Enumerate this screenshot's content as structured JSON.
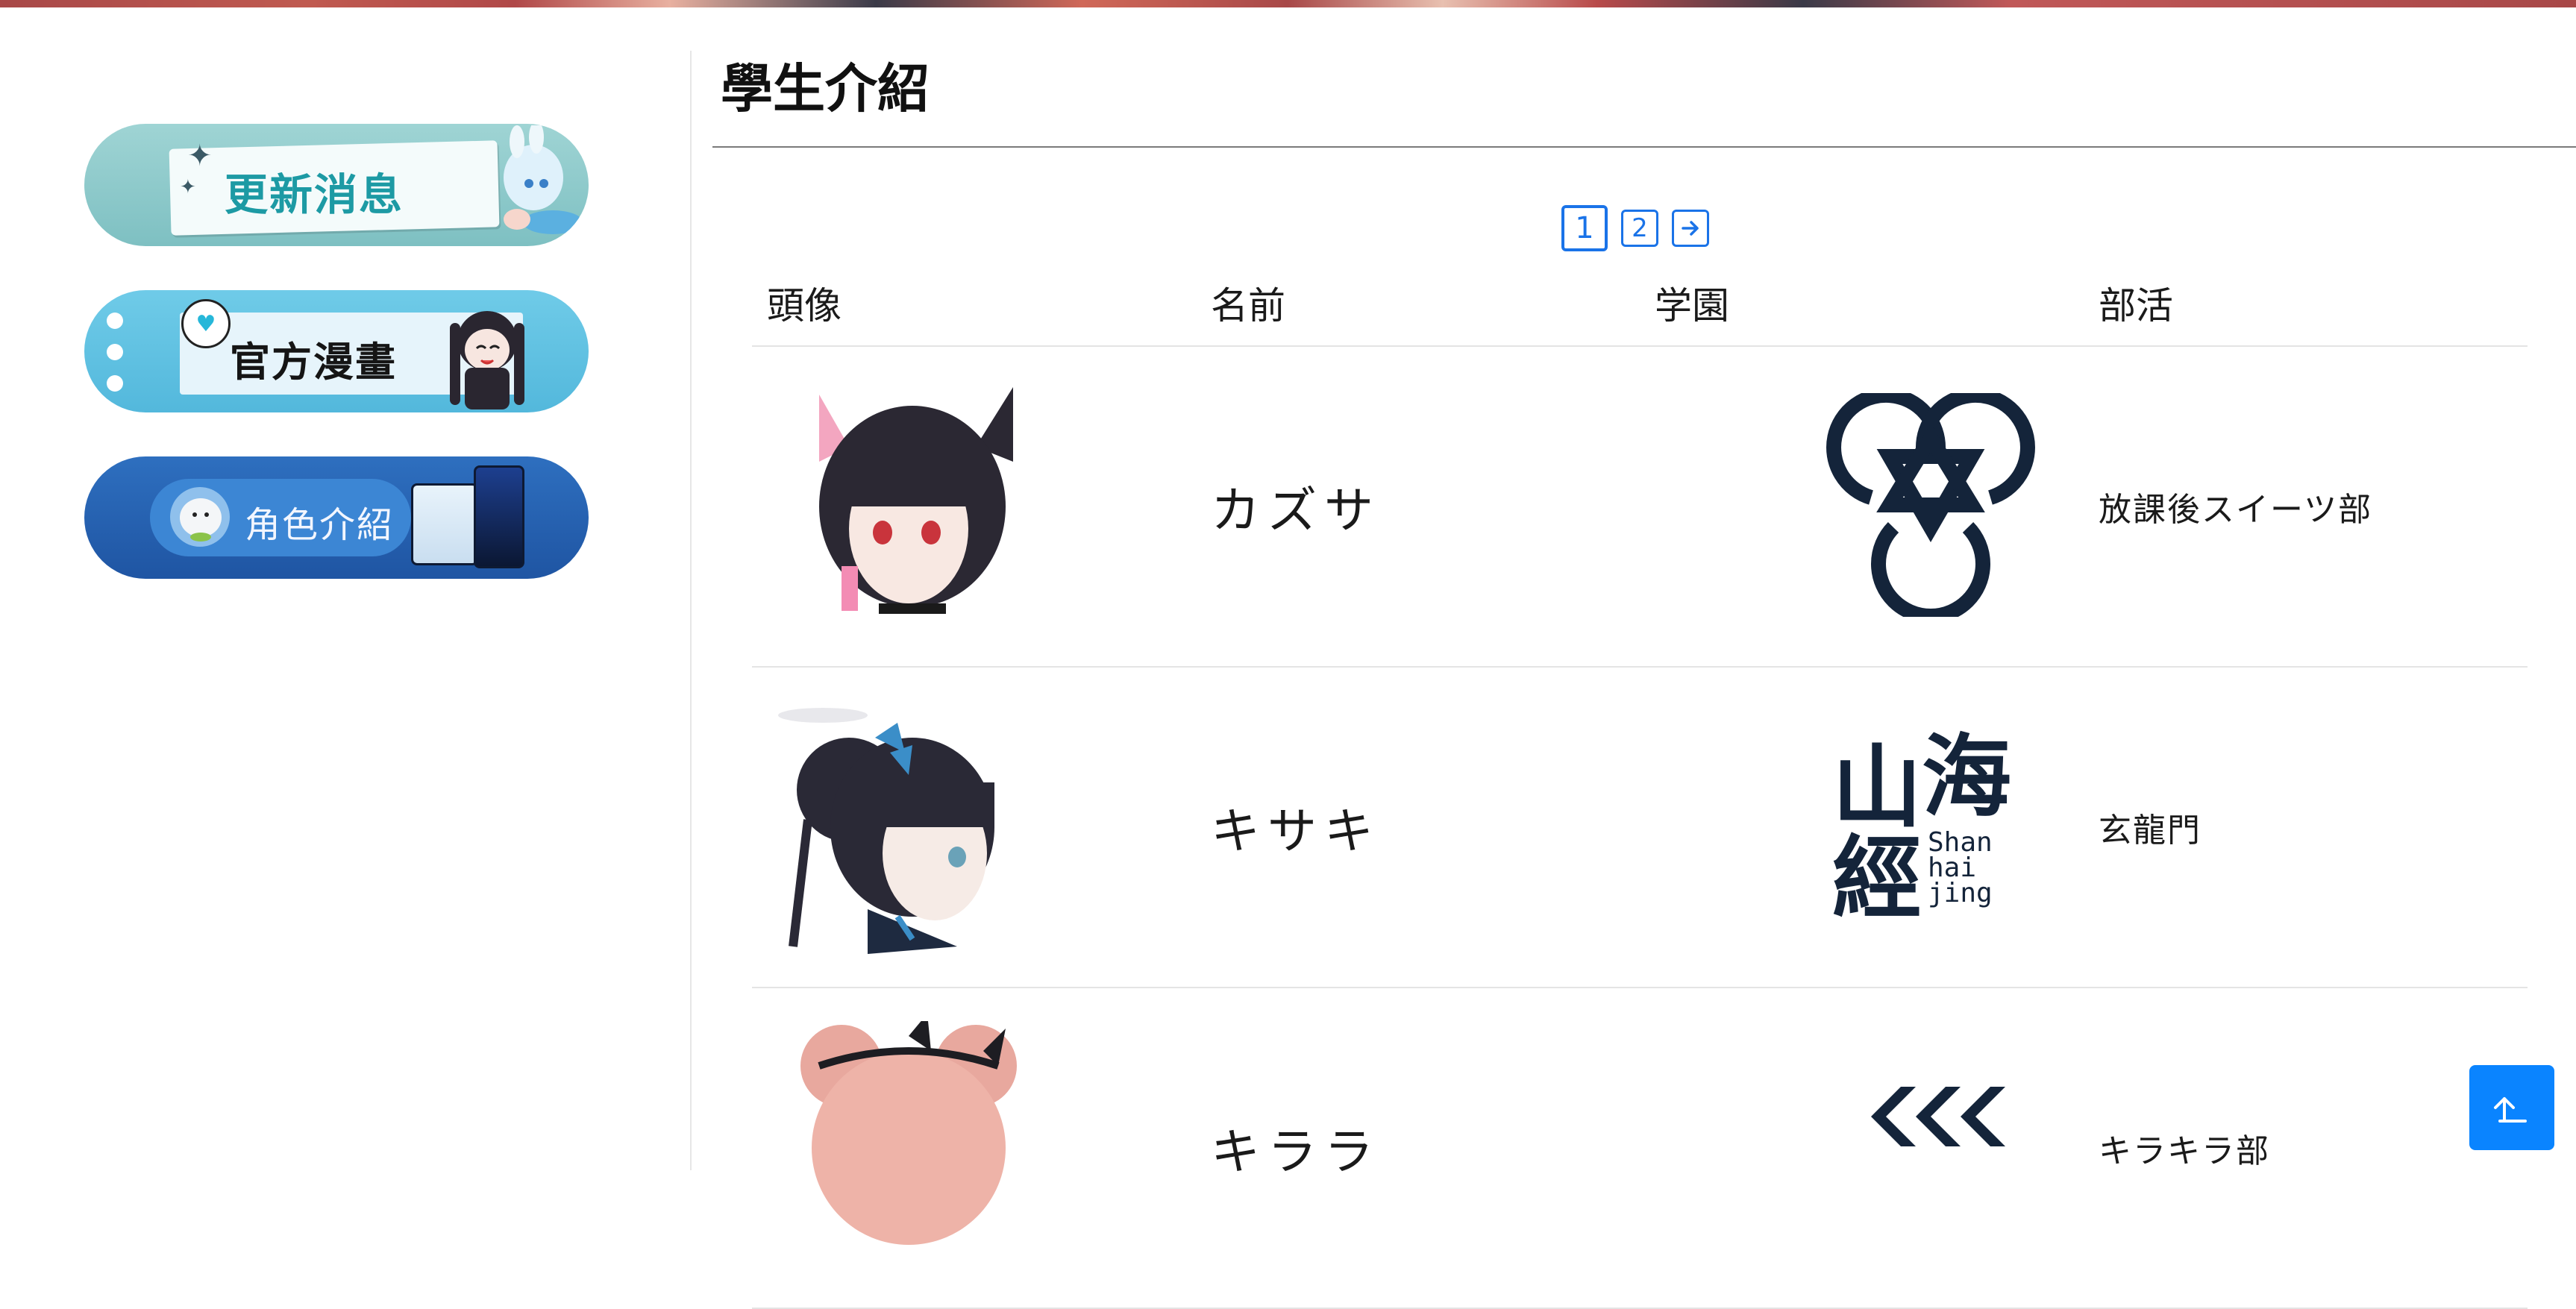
{
  "sidebar": {
    "news_label": "更新消息",
    "comic_label": "官方漫畫",
    "characters_label": "角色介紹"
  },
  "main": {
    "title": "學生介紹",
    "pagination": {
      "pages": [
        "1",
        "2"
      ],
      "current": "1",
      "next_icon": "arrow-right-icon"
    },
    "table": {
      "headers": {
        "avatar": "頭像",
        "name": "名前",
        "school": "学園",
        "club": "部活"
      },
      "rows": [
        {
          "name": "カズサ",
          "school_logo": "trinity-emblem",
          "club": "放課後スイーツ部"
        },
        {
          "name": "キサキ",
          "school_logo": "shanhaijing-emblem",
          "school_logo_text": {
            "big1": "山",
            "big2": "海",
            "big3": "經",
            "small": [
              "Shan",
              "hai",
              "jing"
            ]
          },
          "club": "玄龍門"
        },
        {
          "name": "キララ",
          "school_logo": "chevron-emblem",
          "club": "キラキラ部"
        }
      ]
    }
  },
  "back_to_top_icon": "arrow-up-icon",
  "colors": {
    "accent": "#1a73e8",
    "back_to_top": "#0a84ff",
    "logo_navy": "#14243a"
  }
}
